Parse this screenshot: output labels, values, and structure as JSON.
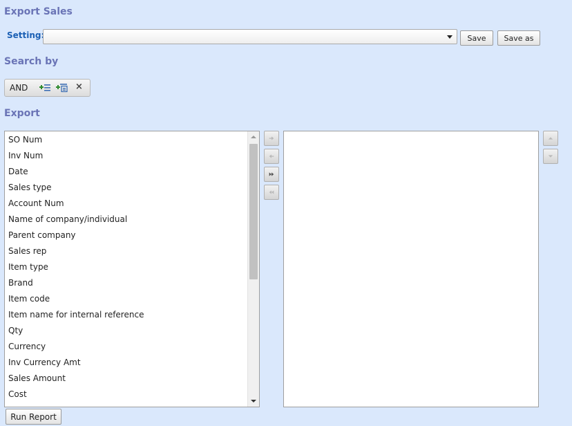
{
  "header": {
    "title": "Export Sales"
  },
  "setting": {
    "label": "Setting:",
    "selected_value": "",
    "save_label": "Save",
    "save_as_label": "Save as"
  },
  "search": {
    "title": "Search by",
    "operator": "AND",
    "icons": [
      "add-condition-icon",
      "add-group-icon",
      "close-icon"
    ]
  },
  "export": {
    "title": "Export",
    "available_fields": [
      "SO Num",
      "Inv Num",
      "Date",
      "Sales type",
      "Account Num",
      "Name of company/individual",
      "Parent company",
      "Sales rep",
      "Item type",
      "Brand",
      "Item code",
      "Item name for internal reference",
      "Qty",
      "Currency",
      "Inv Currency Amt",
      "Sales Amount",
      "Cost"
    ],
    "selected_fields": [],
    "transfer_icons": [
      "arrow-right-icon",
      "arrow-left-icon",
      "double-arrow-right-icon",
      "double-arrow-left-icon"
    ],
    "order_icons": [
      "arrow-up-icon",
      "arrow-down-icon"
    ]
  },
  "footer": {
    "run_report_label": "Run Report"
  },
  "colors": {
    "background": "#dae8fc",
    "section_title": "#6a74b6",
    "setting_label": "#1a5fb4"
  }
}
